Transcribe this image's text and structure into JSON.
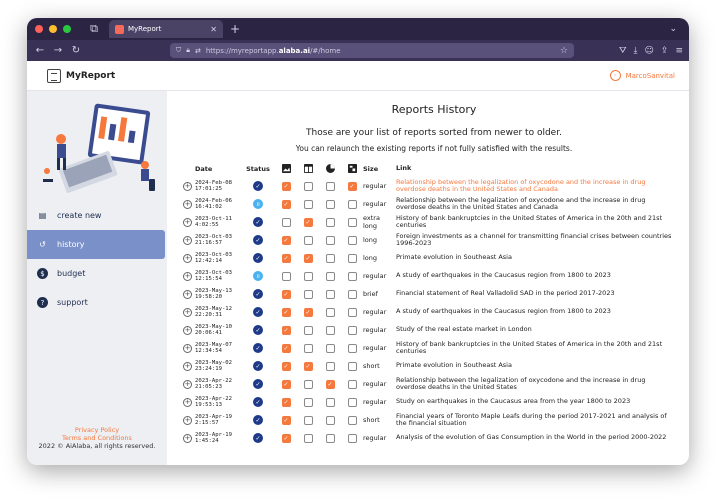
{
  "browser": {
    "tab_title": "MyReport",
    "url_prefix": "https://myreportapp.",
    "url_domain": "alaba.ai",
    "url_suffix": "/#/home"
  },
  "app": {
    "brand": "MyReport",
    "user": "MarcoSanvital"
  },
  "sidebar": {
    "items": [
      {
        "label": "create new",
        "icon": "document-icon",
        "active": false
      },
      {
        "label": "history",
        "icon": "history-icon",
        "active": true
      },
      {
        "label": "budget",
        "icon": "dollar-icon",
        "active": false
      },
      {
        "label": "support",
        "icon": "help-icon",
        "active": false
      }
    ],
    "footer": {
      "privacy": "Privacy Policy",
      "terms": "Terms and Conditions",
      "copyright": "2022 © AiAlaba, all rights reserved."
    }
  },
  "main": {
    "title": "Reports History",
    "subtitle": "Those are your list of reports sorted from newer to older.",
    "hint": "You can relaunch the existing reports if not fully satisfied with the results.",
    "columns": {
      "date": "Date",
      "status": "Status",
      "size": "Size",
      "link": "Link"
    },
    "column_icons": [
      "image-icon",
      "table-icon",
      "pie-chart-icon",
      "word-cloud-icon"
    ],
    "rows": [
      {
        "date1": "2024-Feb-08",
        "date2": "17:01:25",
        "status": "done",
        "opts": [
          true,
          false,
          false,
          true
        ],
        "size": "regular",
        "link": "Relationship between the legalization of oxycodone and the increase in drug overdose deaths in the United States and Canada",
        "highlight": true
      },
      {
        "date1": "2024-Feb-06",
        "date2": "16:41:02",
        "status": "paused",
        "opts": [
          true,
          false,
          false,
          false
        ],
        "size": "regular",
        "link": "Relationship between the legalization of oxycodone and the increase in drug overdose deaths in the United States and Canada",
        "highlight": false
      },
      {
        "date1": "2023-Oct-11",
        "date2": "4:02:55",
        "status": "done",
        "opts": [
          false,
          true,
          false,
          false
        ],
        "size": "extra long",
        "link": "History of bank bankruptcies in the United States of America in the 20th and 21st centuries",
        "highlight": false
      },
      {
        "date1": "2023-Oct-03",
        "date2": "21:16:57",
        "status": "done",
        "opts": [
          true,
          false,
          false,
          false
        ],
        "size": "long",
        "link": "Foreign investments as a channel for transmitting financial crises between countries 1996-2023",
        "highlight": false
      },
      {
        "date1": "2023-Oct-03",
        "date2": "12:42:14",
        "status": "done",
        "opts": [
          true,
          true,
          false,
          false
        ],
        "size": "long",
        "link": "Primate evolution in Southeast Asia",
        "highlight": false
      },
      {
        "date1": "2023-Oct-03",
        "date2": "12:15:54",
        "status": "paused",
        "opts": [
          false,
          false,
          false,
          false
        ],
        "size": "regular",
        "link": "A study of earthquakes in the Caucasus region from 1800 to 2023",
        "highlight": false
      },
      {
        "date1": "2023-May-13",
        "date2": "19:58:20",
        "status": "done",
        "opts": [
          true,
          false,
          false,
          false
        ],
        "size": "brief",
        "link": "Financial statement of Real Valladolid SAD in the period 2017-2023",
        "highlight": false
      },
      {
        "date1": "2023-May-12",
        "date2": "22:20:31",
        "status": "done",
        "opts": [
          true,
          true,
          false,
          false
        ],
        "size": "regular",
        "link": "A study of earthquakes in the Caucasus region from 1800 to 2023",
        "highlight": false
      },
      {
        "date1": "2023-May-10",
        "date2": "20:06:41",
        "status": "done",
        "opts": [
          true,
          false,
          false,
          false
        ],
        "size": "regular",
        "link": "Study of the real estate market in London",
        "highlight": false
      },
      {
        "date1": "2023-May-07",
        "date2": "12:34:54",
        "status": "done",
        "opts": [
          true,
          false,
          false,
          false
        ],
        "size": "regular",
        "link": "History of bank bankruptcies in the United States of America in the 20th and 21st centuries",
        "highlight": false
      },
      {
        "date1": "2023-May-02",
        "date2": "23:24:19",
        "status": "done",
        "opts": [
          true,
          true,
          false,
          false
        ],
        "size": "short",
        "link": "Primate evolution in Southeast Asia",
        "highlight": false
      },
      {
        "date1": "2023-Apr-22",
        "date2": "21:05:23",
        "status": "done",
        "opts": [
          true,
          false,
          true,
          false
        ],
        "size": "regular",
        "link": "Relationship between the legalization of oxycodone and the increase in drug overdose deaths in the United States",
        "highlight": false
      },
      {
        "date1": "2023-Apr-22",
        "date2": "19:53:13",
        "status": "done",
        "opts": [
          true,
          false,
          false,
          false
        ],
        "size": "regular",
        "link": "Study on earthquakes in the Caucasus area from the year 1800 to 2023",
        "highlight": false
      },
      {
        "date1": "2023-Apr-19",
        "date2": "2:15:57",
        "status": "done",
        "opts": [
          true,
          false,
          false,
          false
        ],
        "size": "short",
        "link": "Financial years of Toronto Maple Leafs during the period 2017-2021 and analysis of the financial situation",
        "highlight": false
      },
      {
        "date1": "2023-Apr-19",
        "date2": "1:45:24",
        "status": "done",
        "opts": [
          true,
          false,
          false,
          false
        ],
        "size": "regular",
        "link": "Analysis of the evolution of Gas Consumption in the World in the period 2000-2022",
        "highlight": false
      }
    ]
  }
}
